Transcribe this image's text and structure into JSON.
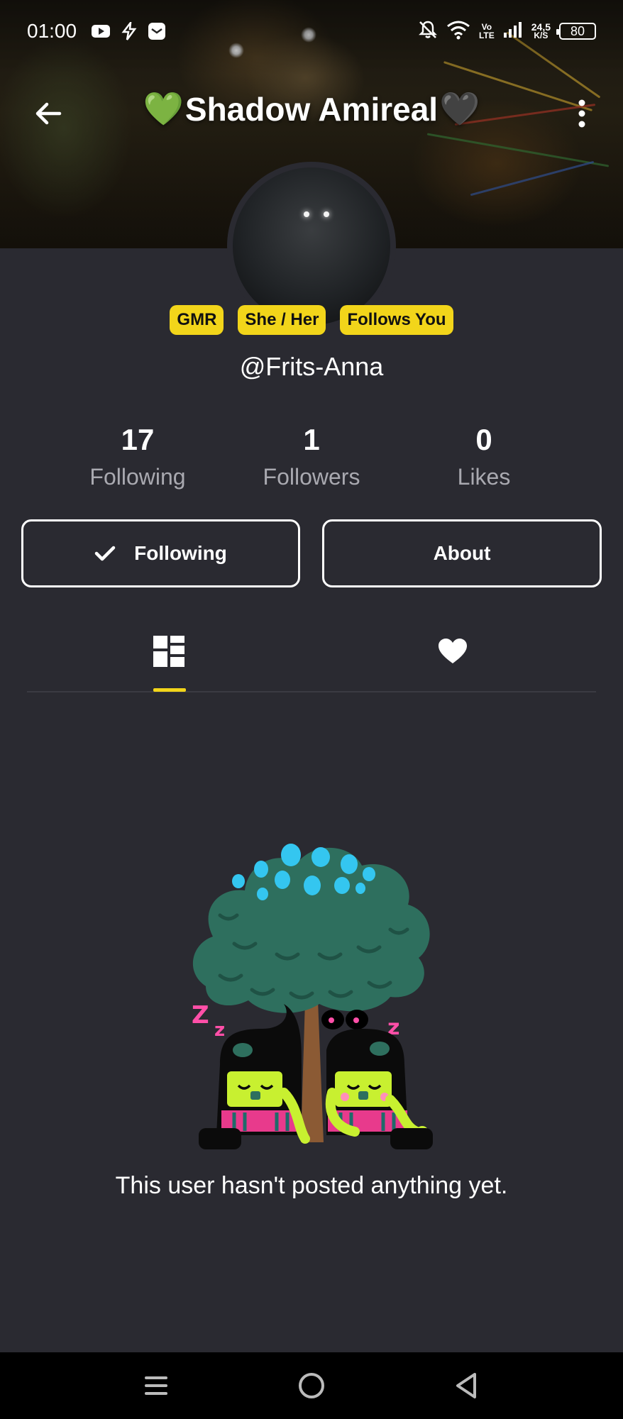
{
  "status_bar": {
    "time": "01:00",
    "network_top": "Vo",
    "network_bottom": "LTE",
    "speed_top": "24,5",
    "speed_bottom": "K/S",
    "battery": "80",
    "icons": [
      "youtube-icon",
      "flash-icon",
      "message-icon",
      "mute-bell-icon",
      "wifi-icon",
      "signal-icon"
    ]
  },
  "header": {
    "title_prefix_emoji": "💚",
    "title": "Shadow Amireal",
    "title_suffix_emoji": "🖤",
    "back_icon": "arrow-left-icon",
    "more_icon": "more-vertical-icon"
  },
  "profile": {
    "badges": [
      "GMR",
      "She / Her",
      "Follows You"
    ],
    "handle": "@Frits-Anna",
    "badge_color": "#f2d51a"
  },
  "stats": [
    {
      "value": "17",
      "label": "Following"
    },
    {
      "value": "1",
      "label": "Followers"
    },
    {
      "value": "0",
      "label": "Likes"
    }
  ],
  "actions": {
    "following_label": "Following",
    "about_label": "About"
  },
  "tabs": {
    "items": [
      "posts-grid-icon",
      "heart-icon"
    ],
    "active": 0
  },
  "empty_state": {
    "message": "This user hasn't posted anything yet.",
    "sleep_text_left": "Z z",
    "sleep_text_right": "z"
  },
  "nav": {
    "items": [
      "menu-icon",
      "home-circle-icon",
      "back-triangle-icon"
    ]
  }
}
